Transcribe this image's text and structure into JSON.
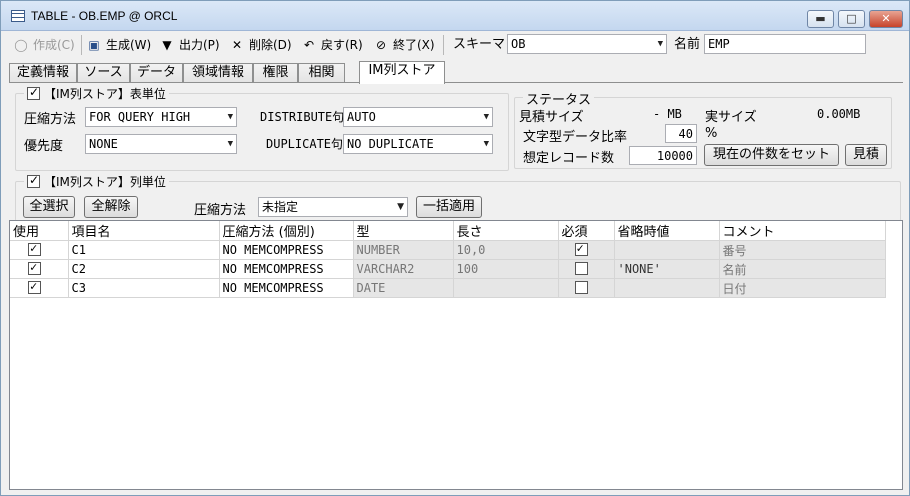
{
  "window": {
    "title": "TABLE - OB.EMP @ ORCL",
    "min": "▬",
    "max": "□",
    "close": "✕"
  },
  "toolbar": {
    "create": "作成(C)",
    "generate": "生成(W)",
    "output": "出力(P)",
    "delete": "削除(D)",
    "back": "戻す(R)",
    "exit": "終了(X)",
    "schema_label": "スキーマ",
    "schema_value": "OB",
    "name_label": "名前",
    "name_value": "EMP"
  },
  "tabs": [
    "定義情報",
    "ソース",
    "データ",
    "領域情報",
    "権限",
    "相関",
    "IM列ストア"
  ],
  "table_unit": {
    "legend": "【IM列ストア】表単位",
    "compression_label": "圧縮方法",
    "compression_value": "FOR QUERY HIGH",
    "distribute_label": "DISTRIBUTE句",
    "distribute_value": "AUTO",
    "priority_label": "優先度",
    "priority_value": "NONE",
    "duplicate_label": "DUPLICATE句",
    "duplicate_value": "NO DUPLICATE"
  },
  "status": {
    "legend": "ステータス",
    "estimate_label": "見積サイズ",
    "estimate_value": "- MB",
    "actual_label": "実サイズ",
    "actual_value": "0.00MB",
    "ratio_label": "文字型データ比率",
    "ratio_value": "40",
    "ratio_unit": "%",
    "records_label": "想定レコード数",
    "records_value": "10000",
    "set_count_button": "現在の件数をセット",
    "estimate_button": "見積"
  },
  "column_unit": {
    "legend": "【IM列ストア】列単位",
    "select_all": "全選択",
    "deselect_all": "全解除",
    "compression_label": "圧縮方法",
    "compression_value": "未指定",
    "apply_all": "一括適用"
  },
  "grid": {
    "headers": [
      "使用",
      "項目名",
      "圧縮方法 (個別)",
      "型",
      "長さ",
      "必須",
      "省略時値",
      "コメント"
    ],
    "rows": [
      {
        "use": true,
        "name": "C1",
        "compress": "NO MEMCOMPRESS",
        "type": "NUMBER",
        "length": "10,0",
        "required": true,
        "default": "",
        "comment": "番号"
      },
      {
        "use": true,
        "name": "C2",
        "compress": "NO MEMCOMPRESS",
        "type": "VARCHAR2",
        "length": "100",
        "required": false,
        "default": "'NONE'",
        "comment": "名前"
      },
      {
        "use": true,
        "name": "C3",
        "compress": "NO MEMCOMPRESS",
        "type": "DATE",
        "length": "",
        "required": false,
        "default": "",
        "comment": "日付"
      }
    ]
  },
  "icons": [
    "table-icon",
    "create-icon",
    "generate-icon",
    "output-icon",
    "delete-icon",
    "undo-icon",
    "exit-icon",
    "dropdown-arrow-icon",
    "checkbox-icon"
  ]
}
